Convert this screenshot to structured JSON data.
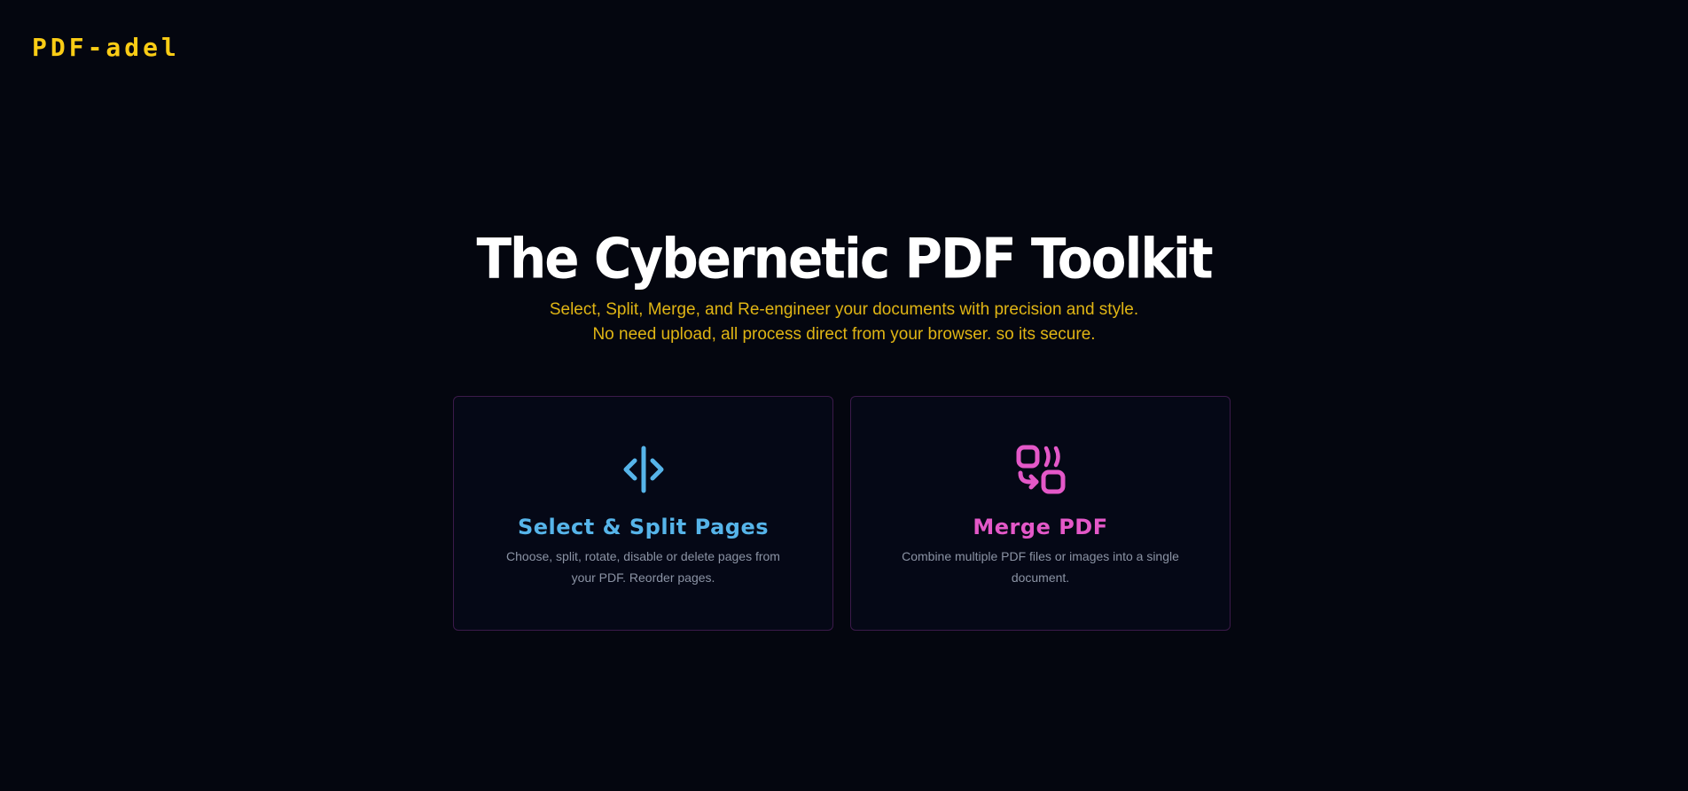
{
  "brand": {
    "logo_text": "PDF-adel",
    "accent_color": "#facc15"
  },
  "hero": {
    "title": "The Cybernetic PDF Toolkit",
    "subtitle_line1": "Select, Split, Merge, and Re-engineer your documents with precision and style.",
    "subtitle_line2": "No need upload, all process direct from your browser. so its secure."
  },
  "tools": [
    {
      "title": "Select & Split Pages",
      "description": "Choose, split, rotate, disable or delete pages from your PDF. Reorder pages.",
      "icon": "split-icon",
      "color": "#56b4e9"
    },
    {
      "title": "Merge PDF",
      "description": "Combine multiple PDF files or images into a single document.",
      "icon": "merge-icon",
      "color": "#e458c8"
    }
  ],
  "colors": {
    "background": "#04060f",
    "card_border": "#3b1a4a",
    "title": "#ffffff",
    "subtitle": "#e0b514"
  }
}
